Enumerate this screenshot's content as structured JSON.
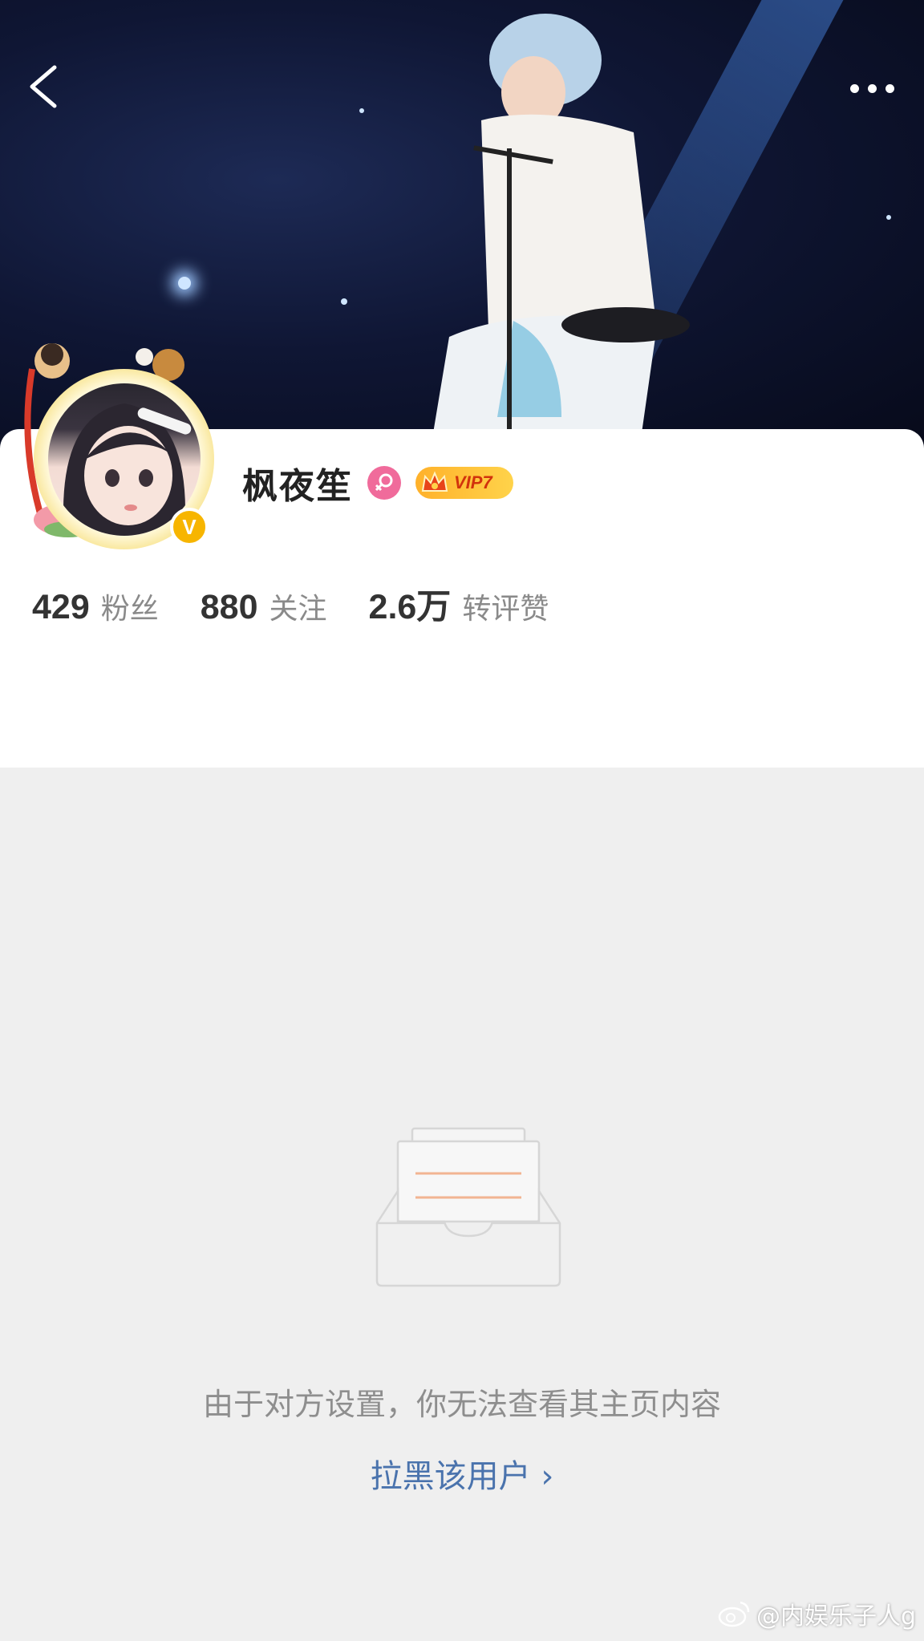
{
  "header": {
    "back_icon": "chevron-left-icon",
    "more_icon": "ellipsis-icon"
  },
  "profile": {
    "username": "枫夜笙",
    "gender_icon": "female-icon",
    "vip_label": "VIP7",
    "verified_icon": "v-badge-icon",
    "verified_label": "V"
  },
  "stats": [
    {
      "value": "429",
      "label": "粉丝"
    },
    {
      "value": "880",
      "label": "关注"
    },
    {
      "value": "2.6万",
      "label": "转评赞"
    }
  ],
  "empty_state": {
    "illustration_icon": "empty-box-icon",
    "message": "由于对方设置，你无法查看其主页内容",
    "action_label": "拉黑该用户 ›"
  },
  "watermark": {
    "icon": "weibo-logo-icon",
    "text": "@内娱乐子人g"
  },
  "colors": {
    "link": "#4a73ad",
    "vip_gold": "#ffb12a",
    "gender_pink": "#f06b9b",
    "verified_yellow": "#f7b500"
  }
}
